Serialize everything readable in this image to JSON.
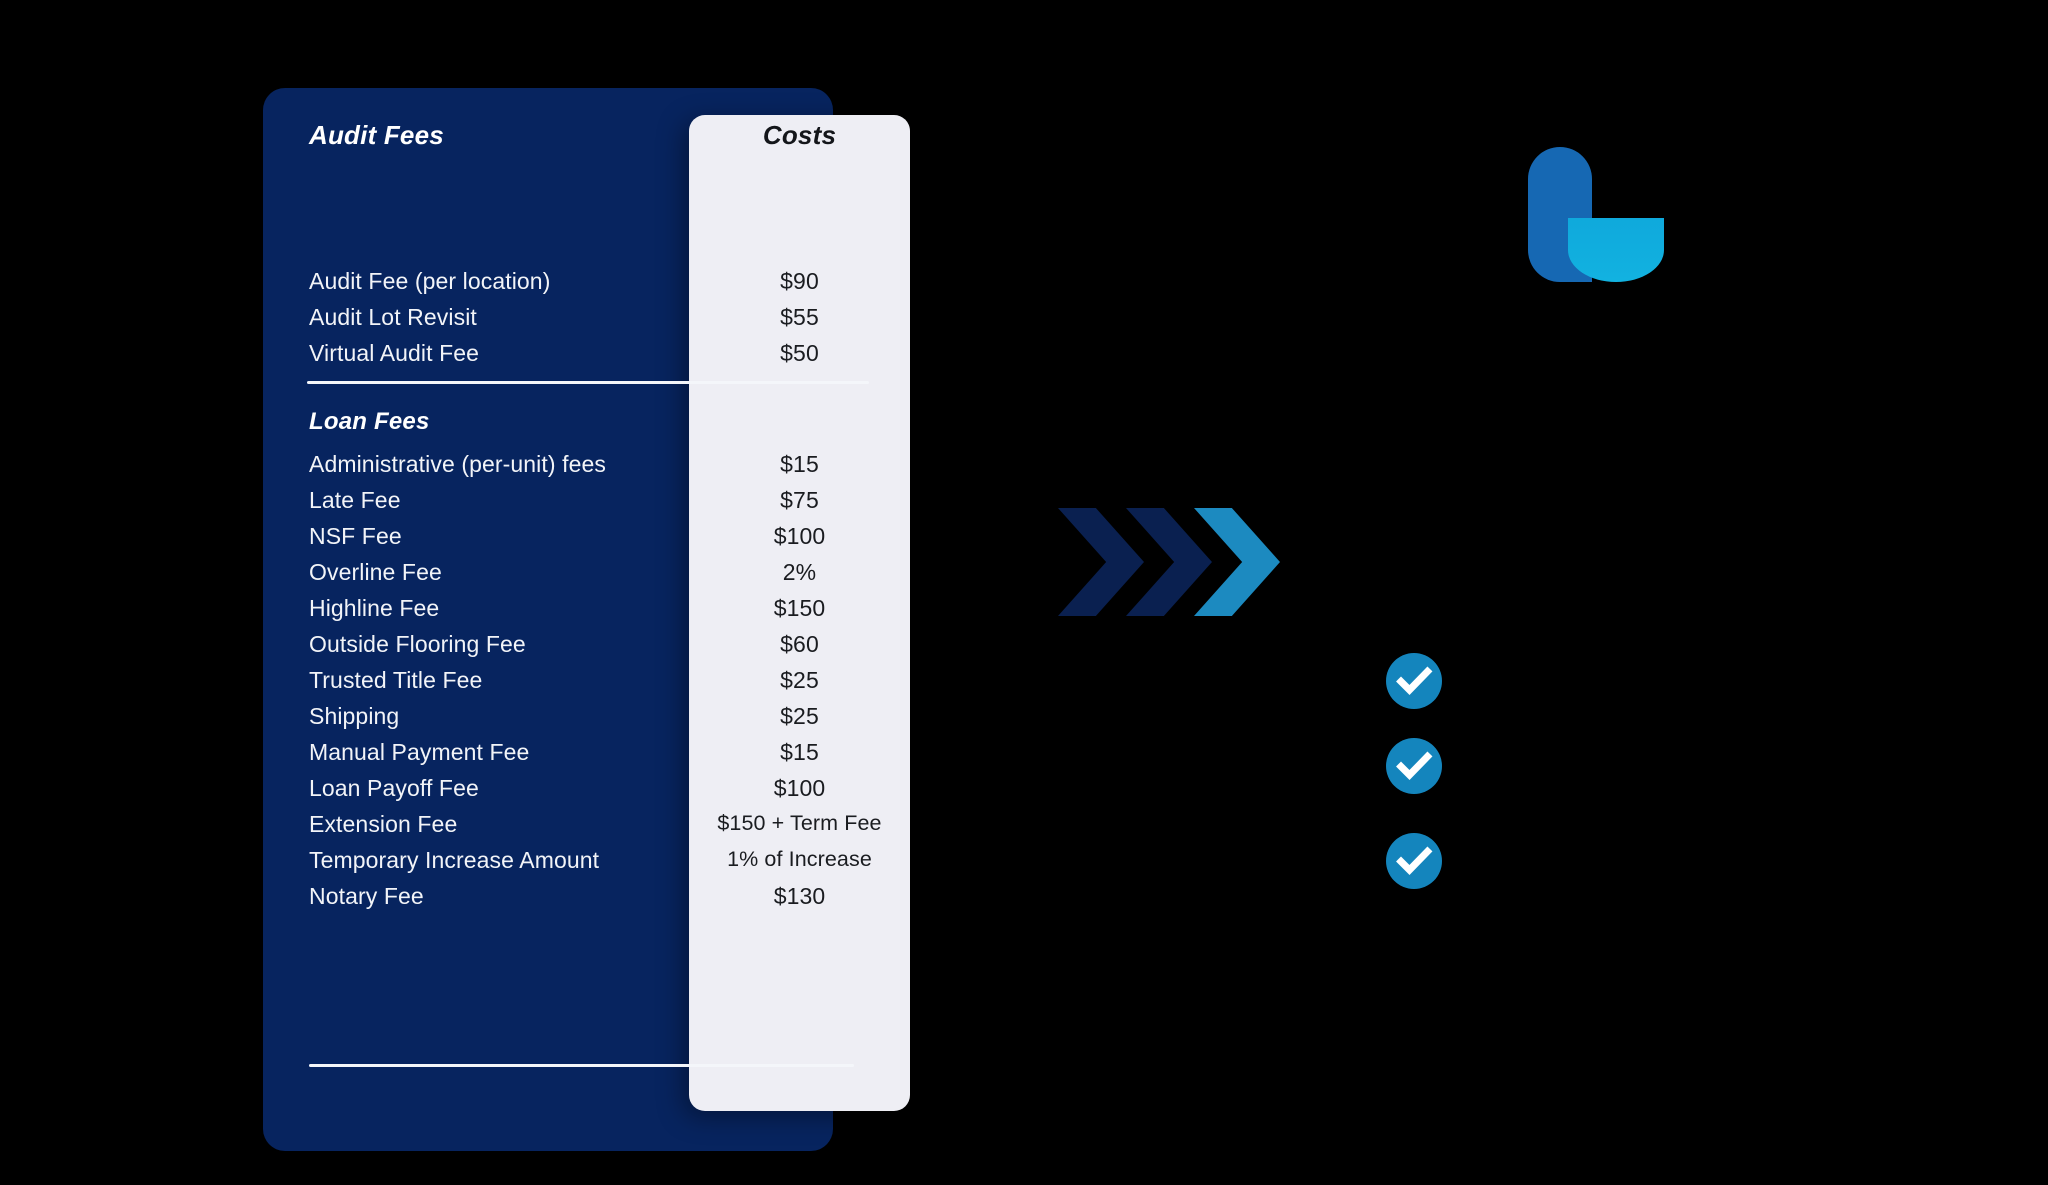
{
  "table": {
    "header": {
      "left_label": "Audit Fees",
      "right_label": "Costs"
    },
    "sections": [
      {
        "title": "Audit Fees",
        "is_header_title": true,
        "rows": [
          {
            "name": "Audit Fee (per location)",
            "cost": "$90"
          },
          {
            "name": "Audit Lot Revisit",
            "cost": "$55"
          },
          {
            "name": "Virtual Audit Fee",
            "cost": "$50"
          }
        ]
      },
      {
        "title": "Loan Fees",
        "is_header_title": false,
        "rows": [
          {
            "name": "Administrative (per-unit) fees",
            "cost": "$15"
          },
          {
            "name": "Late Fee",
            "cost": "$75"
          },
          {
            "name": "NSF Fee",
            "cost": "$100"
          },
          {
            "name": "Overline Fee",
            "cost": "2%"
          },
          {
            "name": "Highline Fee",
            "cost": "$150"
          },
          {
            "name": "Outside Flooring Fee",
            "cost": "$60"
          },
          {
            "name": "Trusted Title Fee",
            "cost": "$25"
          },
          {
            "name": "Shipping",
            "cost": "$25"
          },
          {
            "name": "Manual Payment Fee",
            "cost": "$15"
          },
          {
            "name": "Loan Payoff Fee",
            "cost": "$100"
          },
          {
            "name": "Extension Fee",
            "cost": "$150 + Term Fee"
          },
          {
            "name": "Temporary Increase Amount",
            "cost": "1% of Increase"
          },
          {
            "name": "Notary Fee",
            "cost": "$130"
          }
        ]
      }
    ]
  },
  "decorations": {
    "logo": {
      "name": "brand-logo-l",
      "stem_color": "#1668B3",
      "bowl_color": "#12B2E0"
    },
    "chevrons": [
      {
        "name": "chevron-1",
        "color": "#0A2050"
      },
      {
        "name": "chevron-2",
        "color": "#0A2050"
      },
      {
        "name": "chevron-3",
        "color": "#1C8AC0"
      }
    ],
    "check_badges": [
      {
        "name": "check-badge-1",
        "color": "#1485BD"
      },
      {
        "name": "check-badge-2",
        "color": "#1485BD"
      },
      {
        "name": "check-badge-3",
        "color": "#1485BD"
      }
    ]
  },
  "colors": {
    "card_navy": "#07245F",
    "costs_panel": "#EEEEF4",
    "background": "#000000",
    "divider": "#F4F6FA",
    "accent_blue": "#1485BD"
  }
}
